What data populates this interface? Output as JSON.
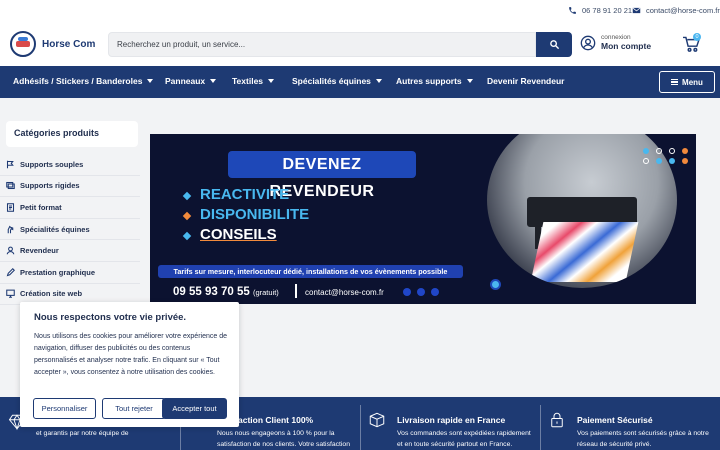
{
  "topbar": {
    "phone": "06 78 91 20 21",
    "email": "contact@horse-com.fr"
  },
  "header": {
    "brand": "Horse Com",
    "search_placeholder": "Recherchez un produit, un service...",
    "account_small": "connexion",
    "account_big": "Mon compte",
    "cart_count": "0"
  },
  "nav": {
    "items": [
      {
        "label": "Adhésifs / Stickers / Banderoles"
      },
      {
        "label": "Panneaux"
      },
      {
        "label": "Textiles"
      },
      {
        "label": "Spécialités équines"
      },
      {
        "label": "Autres supports"
      },
      {
        "label": "Devenir Revendeur"
      }
    ],
    "menu_label": "Menu"
  },
  "sidebar": {
    "title": "Catégories produits",
    "items": [
      {
        "label": "Supports souples",
        "icon": "flag-icon"
      },
      {
        "label": "Supports rigides",
        "icon": "panel-icon"
      },
      {
        "label": "Petit format",
        "icon": "document-icon"
      },
      {
        "label": "Spécialités équines",
        "icon": "horse-icon"
      },
      {
        "label": "Revendeur",
        "icon": "user-icon"
      },
      {
        "label": "Prestation graphique",
        "icon": "pen-icon"
      },
      {
        "label": "Création site web",
        "icon": "monitor-icon"
      }
    ]
  },
  "banner": {
    "headline": "DEVENEZ REVENDEUR",
    "keywords": [
      "REACTIVITE",
      "DISPONIBILITE",
      "CONSEILS"
    ],
    "strip": "Tarifs sur mesure, interlocuteur dédié, installations de vos évènements possible",
    "phone": "09 55 93 70 55",
    "phone_note": "(gratuit)",
    "email": "contact@horse-com.fr"
  },
  "cookie": {
    "title": "Nous respectons votre vie privée.",
    "text": "Nous utilisons des cookies pour améliorer votre expérience de navigation, diffuser des publicités ou des contenus personnalisés et analyser notre trafic. En cliquant sur « Tout accepter », vous consentez à notre utilisation des cookies.",
    "customize": "Personnaliser",
    "reject": "Tout rejeter",
    "accept": "Accepter tout"
  },
  "features": [
    {
      "title": "",
      "line1": "et garantis par notre équipe de",
      "line2": ""
    },
    {
      "title": "action Client 100%",
      "line1": "Nous nous engageons à 100 % pour la",
      "line2": "satisfaction de nos clients. Votre satisfaction"
    },
    {
      "title": "Livraison rapide en France",
      "line1": "Vos commandes sont expédiées rapidement",
      "line2": "et en toute sécurité partout en France."
    },
    {
      "title": "Paiement Sécurisé",
      "line1": "Vos paiements sont sécurisés grâce à notre",
      "line2": "réseau de sécurité privé."
    }
  ],
  "colors": {
    "primary": "#1e3a73",
    "accent": "#4bb6f0",
    "orange": "#f28a3c"
  }
}
